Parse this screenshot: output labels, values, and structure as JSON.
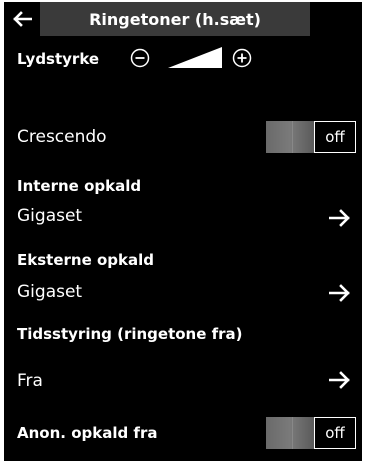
{
  "header": {
    "title": "Ringetoner (h.sæt)"
  },
  "volume": {
    "label": "Lydstyrke"
  },
  "crescendo": {
    "label": "Crescendo",
    "state": "off"
  },
  "internal": {
    "heading": "Interne opkald",
    "value": "Gigaset"
  },
  "external": {
    "heading": "Eksterne opkald",
    "value": "Gigaset"
  },
  "timer": {
    "heading": "Tidsstyring (ringetone fra)",
    "value": "Fra"
  },
  "anon": {
    "label": "Anon. opkald fra",
    "state": "off"
  },
  "icons": [
    "back-arrow-icon",
    "volume-down-icon",
    "volume-up-icon",
    "right-arrow-icon"
  ]
}
